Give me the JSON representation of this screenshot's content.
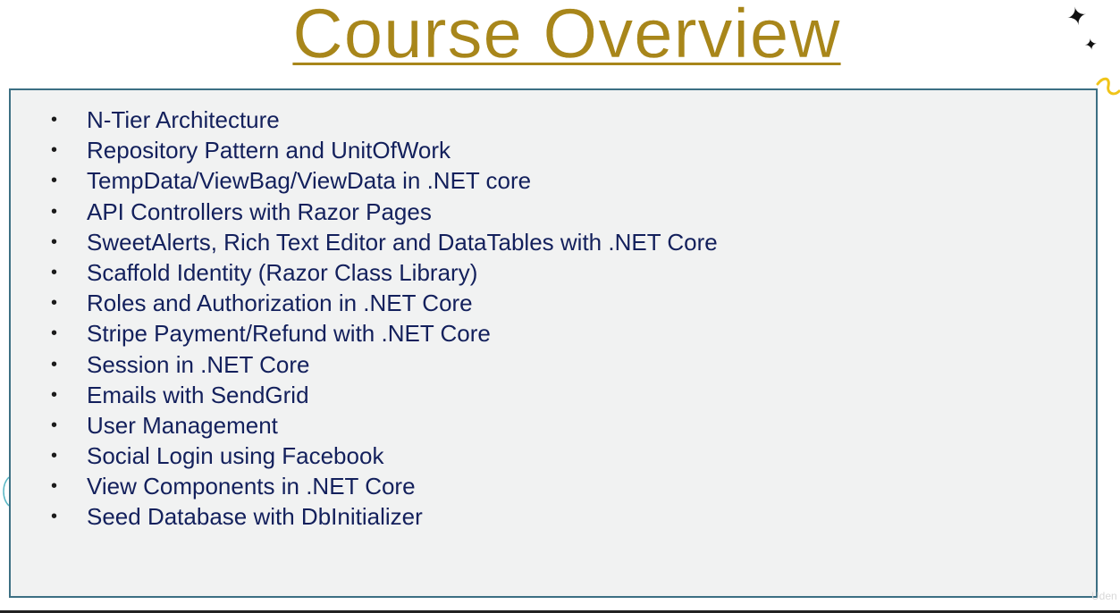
{
  "slide": {
    "title": "Course Overview",
    "topics": [
      "N-Tier Architecture",
      "Repository Pattern and UnitOfWork",
      "TempData/ViewBag/ViewData in .NET core",
      "API Controllers with Razor Pages",
      "SweetAlerts, Rich Text Editor and DataTables with .NET Core",
      "Scaffold Identity (Razor Class Library)",
      "Roles and Authorization in .NET Core",
      "Stripe Payment/Refund with .NET Core",
      "Session in .NET Core",
      "Emails with SendGrid",
      "User Management",
      "Social Login using Facebook",
      "View Components in .NET Core",
      "Seed Database with DbInitializer"
    ],
    "bullet_symbol": "•",
    "watermark": "Uden"
  },
  "colors": {
    "title": "#a8861a",
    "topic_text": "#13205c",
    "box_border": "#3c6f83",
    "box_background": "#f1f2f2",
    "curl_accent": "#f0c419"
  },
  "icons": {
    "sparkle": "four-point-star",
    "curl": "gold-curl"
  }
}
